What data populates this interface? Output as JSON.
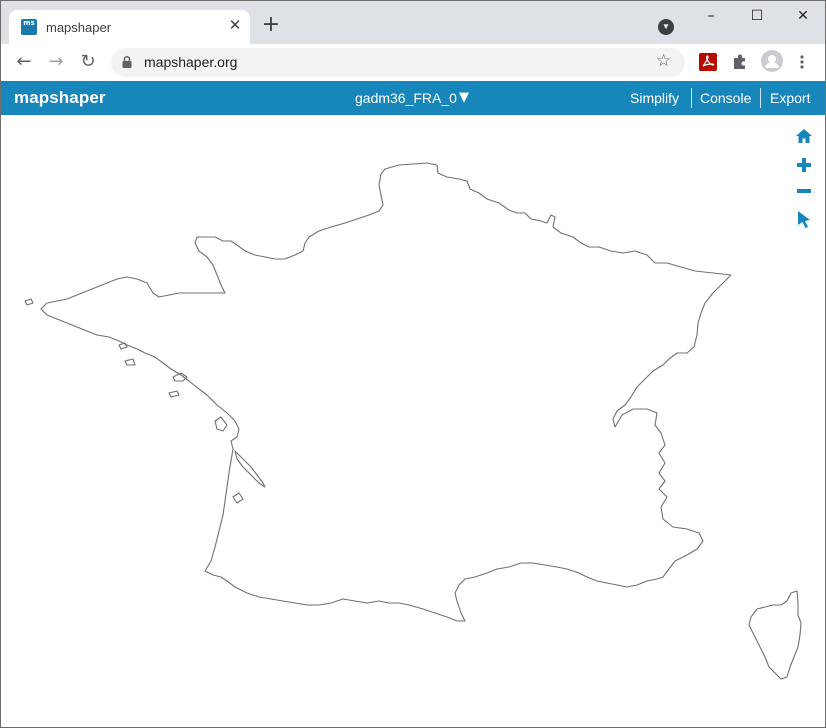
{
  "browser": {
    "tab_title": "mapshaper",
    "favicon_text": "ms",
    "tab_close": "✕",
    "new_tab": "+",
    "window_controls": {
      "minimize": "–",
      "maximize": "☐",
      "close": "✕"
    },
    "url": "mapshaper.org",
    "icons": [
      "back-arrow-icon",
      "forward-arrow-icon",
      "reload-icon",
      "lock-icon",
      "star-icon",
      "pdf-extension-icon",
      "puzzle-extension-icon",
      "profile-avatar-icon",
      "more-menu-icon",
      "tab-search-icon"
    ]
  },
  "app": {
    "brand": "mapshaper",
    "brand_color": "#1786bb",
    "layer_name": "gadm36_FRA_0",
    "layer_caret": "▼",
    "menu": [
      "Simplify",
      "Console",
      "Export"
    ],
    "map_tools": [
      "home-icon",
      "zoom-in-icon",
      "zoom-out-icon",
      "pointer-select-icon"
    ],
    "tool_color": "#1786bb",
    "outline_color": "#6f6f7a"
  }
}
